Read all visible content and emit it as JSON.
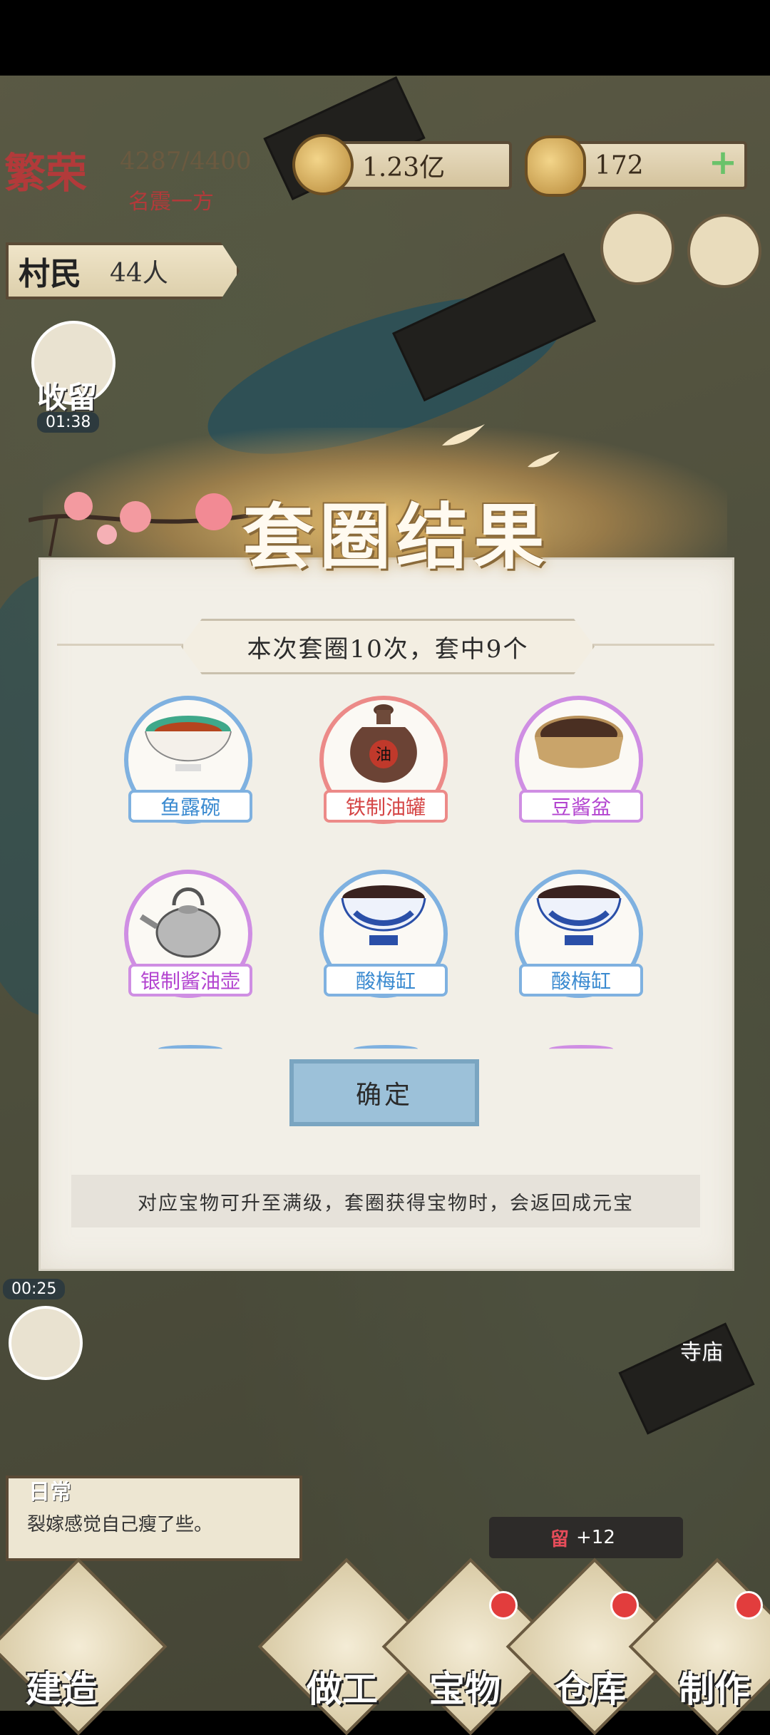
{
  "hud": {
    "prosperity_label": "繁荣",
    "prosperity_value": "4287/4400",
    "prosperity_sub": "名震一方",
    "money": "1.23亿",
    "gold": "172",
    "villager_label": "村民",
    "villager_count": "44人",
    "recruit_label": "收留",
    "recruit_timer": "01:38",
    "timer2": "00:25"
  },
  "modal": {
    "title": "套圈结果",
    "summary": "本次套圈10次，套中9个",
    "items": [
      {
        "label": "鱼露碗",
        "color": "blue",
        "icon": "bowl-icon"
      },
      {
        "label": "铁制油罐",
        "color": "red",
        "icon": "oil-jar-icon"
      },
      {
        "label": "豆酱盆",
        "color": "purple",
        "icon": "sauce-basin-icon"
      },
      {
        "label": "银制酱油壶",
        "color": "purple",
        "icon": "teapot-icon"
      },
      {
        "label": "酸梅缸",
        "color": "blue",
        "icon": "porcelain-bowl-icon"
      },
      {
        "label": "酸梅缸",
        "color": "blue",
        "icon": "porcelain-bowl-icon"
      }
    ],
    "jar_char": "油",
    "confirm": "确定",
    "tip": "对应宝物可升至满级，套圈获得宝物时，会返回成元宝"
  },
  "bottom": {
    "daily_title": "日常",
    "daily_text": "裂嫁感觉自己瘦了些。",
    "notice_count": "+12",
    "notice_glyph": "留",
    "temple": "寺庙",
    "nav": [
      "建造",
      "做工",
      "宝物",
      "仓库",
      "制作"
    ]
  },
  "colors": {
    "blue": "#7fb1e0",
    "red": "#ec8a88",
    "purple": "#cf8ee3",
    "confirm": "#9cc1d9"
  }
}
